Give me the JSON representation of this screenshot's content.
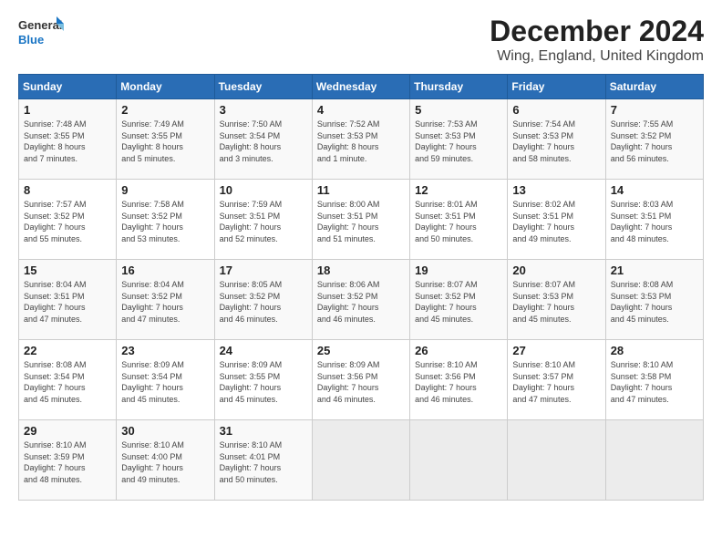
{
  "header": {
    "logo_line1": "General",
    "logo_line2": "Blue",
    "title": "December 2024",
    "subtitle": "Wing, England, United Kingdom"
  },
  "days_of_week": [
    "Sunday",
    "Monday",
    "Tuesday",
    "Wednesday",
    "Thursday",
    "Friday",
    "Saturday"
  ],
  "weeks": [
    [
      {
        "day": "1",
        "info": "Sunrise: 7:48 AM\nSunset: 3:55 PM\nDaylight: 8 hours\nand 7 minutes."
      },
      {
        "day": "2",
        "info": "Sunrise: 7:49 AM\nSunset: 3:55 PM\nDaylight: 8 hours\nand 5 minutes."
      },
      {
        "day": "3",
        "info": "Sunrise: 7:50 AM\nSunset: 3:54 PM\nDaylight: 8 hours\nand 3 minutes."
      },
      {
        "day": "4",
        "info": "Sunrise: 7:52 AM\nSunset: 3:53 PM\nDaylight: 8 hours\nand 1 minute."
      },
      {
        "day": "5",
        "info": "Sunrise: 7:53 AM\nSunset: 3:53 PM\nDaylight: 7 hours\nand 59 minutes."
      },
      {
        "day": "6",
        "info": "Sunrise: 7:54 AM\nSunset: 3:53 PM\nDaylight: 7 hours\nand 58 minutes."
      },
      {
        "day": "7",
        "info": "Sunrise: 7:55 AM\nSunset: 3:52 PM\nDaylight: 7 hours\nand 56 minutes."
      }
    ],
    [
      {
        "day": "8",
        "info": "Sunrise: 7:57 AM\nSunset: 3:52 PM\nDaylight: 7 hours\nand 55 minutes."
      },
      {
        "day": "9",
        "info": "Sunrise: 7:58 AM\nSunset: 3:52 PM\nDaylight: 7 hours\nand 53 minutes."
      },
      {
        "day": "10",
        "info": "Sunrise: 7:59 AM\nSunset: 3:51 PM\nDaylight: 7 hours\nand 52 minutes."
      },
      {
        "day": "11",
        "info": "Sunrise: 8:00 AM\nSunset: 3:51 PM\nDaylight: 7 hours\nand 51 minutes."
      },
      {
        "day": "12",
        "info": "Sunrise: 8:01 AM\nSunset: 3:51 PM\nDaylight: 7 hours\nand 50 minutes."
      },
      {
        "day": "13",
        "info": "Sunrise: 8:02 AM\nSunset: 3:51 PM\nDaylight: 7 hours\nand 49 minutes."
      },
      {
        "day": "14",
        "info": "Sunrise: 8:03 AM\nSunset: 3:51 PM\nDaylight: 7 hours\nand 48 minutes."
      }
    ],
    [
      {
        "day": "15",
        "info": "Sunrise: 8:04 AM\nSunset: 3:51 PM\nDaylight: 7 hours\nand 47 minutes."
      },
      {
        "day": "16",
        "info": "Sunrise: 8:04 AM\nSunset: 3:52 PM\nDaylight: 7 hours\nand 47 minutes."
      },
      {
        "day": "17",
        "info": "Sunrise: 8:05 AM\nSunset: 3:52 PM\nDaylight: 7 hours\nand 46 minutes."
      },
      {
        "day": "18",
        "info": "Sunrise: 8:06 AM\nSunset: 3:52 PM\nDaylight: 7 hours\nand 46 minutes."
      },
      {
        "day": "19",
        "info": "Sunrise: 8:07 AM\nSunset: 3:52 PM\nDaylight: 7 hours\nand 45 minutes."
      },
      {
        "day": "20",
        "info": "Sunrise: 8:07 AM\nSunset: 3:53 PM\nDaylight: 7 hours\nand 45 minutes."
      },
      {
        "day": "21",
        "info": "Sunrise: 8:08 AM\nSunset: 3:53 PM\nDaylight: 7 hours\nand 45 minutes."
      }
    ],
    [
      {
        "day": "22",
        "info": "Sunrise: 8:08 AM\nSunset: 3:54 PM\nDaylight: 7 hours\nand 45 minutes."
      },
      {
        "day": "23",
        "info": "Sunrise: 8:09 AM\nSunset: 3:54 PM\nDaylight: 7 hours\nand 45 minutes."
      },
      {
        "day": "24",
        "info": "Sunrise: 8:09 AM\nSunset: 3:55 PM\nDaylight: 7 hours\nand 45 minutes."
      },
      {
        "day": "25",
        "info": "Sunrise: 8:09 AM\nSunset: 3:56 PM\nDaylight: 7 hours\nand 46 minutes."
      },
      {
        "day": "26",
        "info": "Sunrise: 8:10 AM\nSunset: 3:56 PM\nDaylight: 7 hours\nand 46 minutes."
      },
      {
        "day": "27",
        "info": "Sunrise: 8:10 AM\nSunset: 3:57 PM\nDaylight: 7 hours\nand 47 minutes."
      },
      {
        "day": "28",
        "info": "Sunrise: 8:10 AM\nSunset: 3:58 PM\nDaylight: 7 hours\nand 47 minutes."
      }
    ],
    [
      {
        "day": "29",
        "info": "Sunrise: 8:10 AM\nSunset: 3:59 PM\nDaylight: 7 hours\nand 48 minutes."
      },
      {
        "day": "30",
        "info": "Sunrise: 8:10 AM\nSunset: 4:00 PM\nDaylight: 7 hours\nand 49 minutes."
      },
      {
        "day": "31",
        "info": "Sunrise: 8:10 AM\nSunset: 4:01 PM\nDaylight: 7 hours\nand 50 minutes."
      },
      {
        "day": "",
        "info": ""
      },
      {
        "day": "",
        "info": ""
      },
      {
        "day": "",
        "info": ""
      },
      {
        "day": "",
        "info": ""
      }
    ]
  ]
}
